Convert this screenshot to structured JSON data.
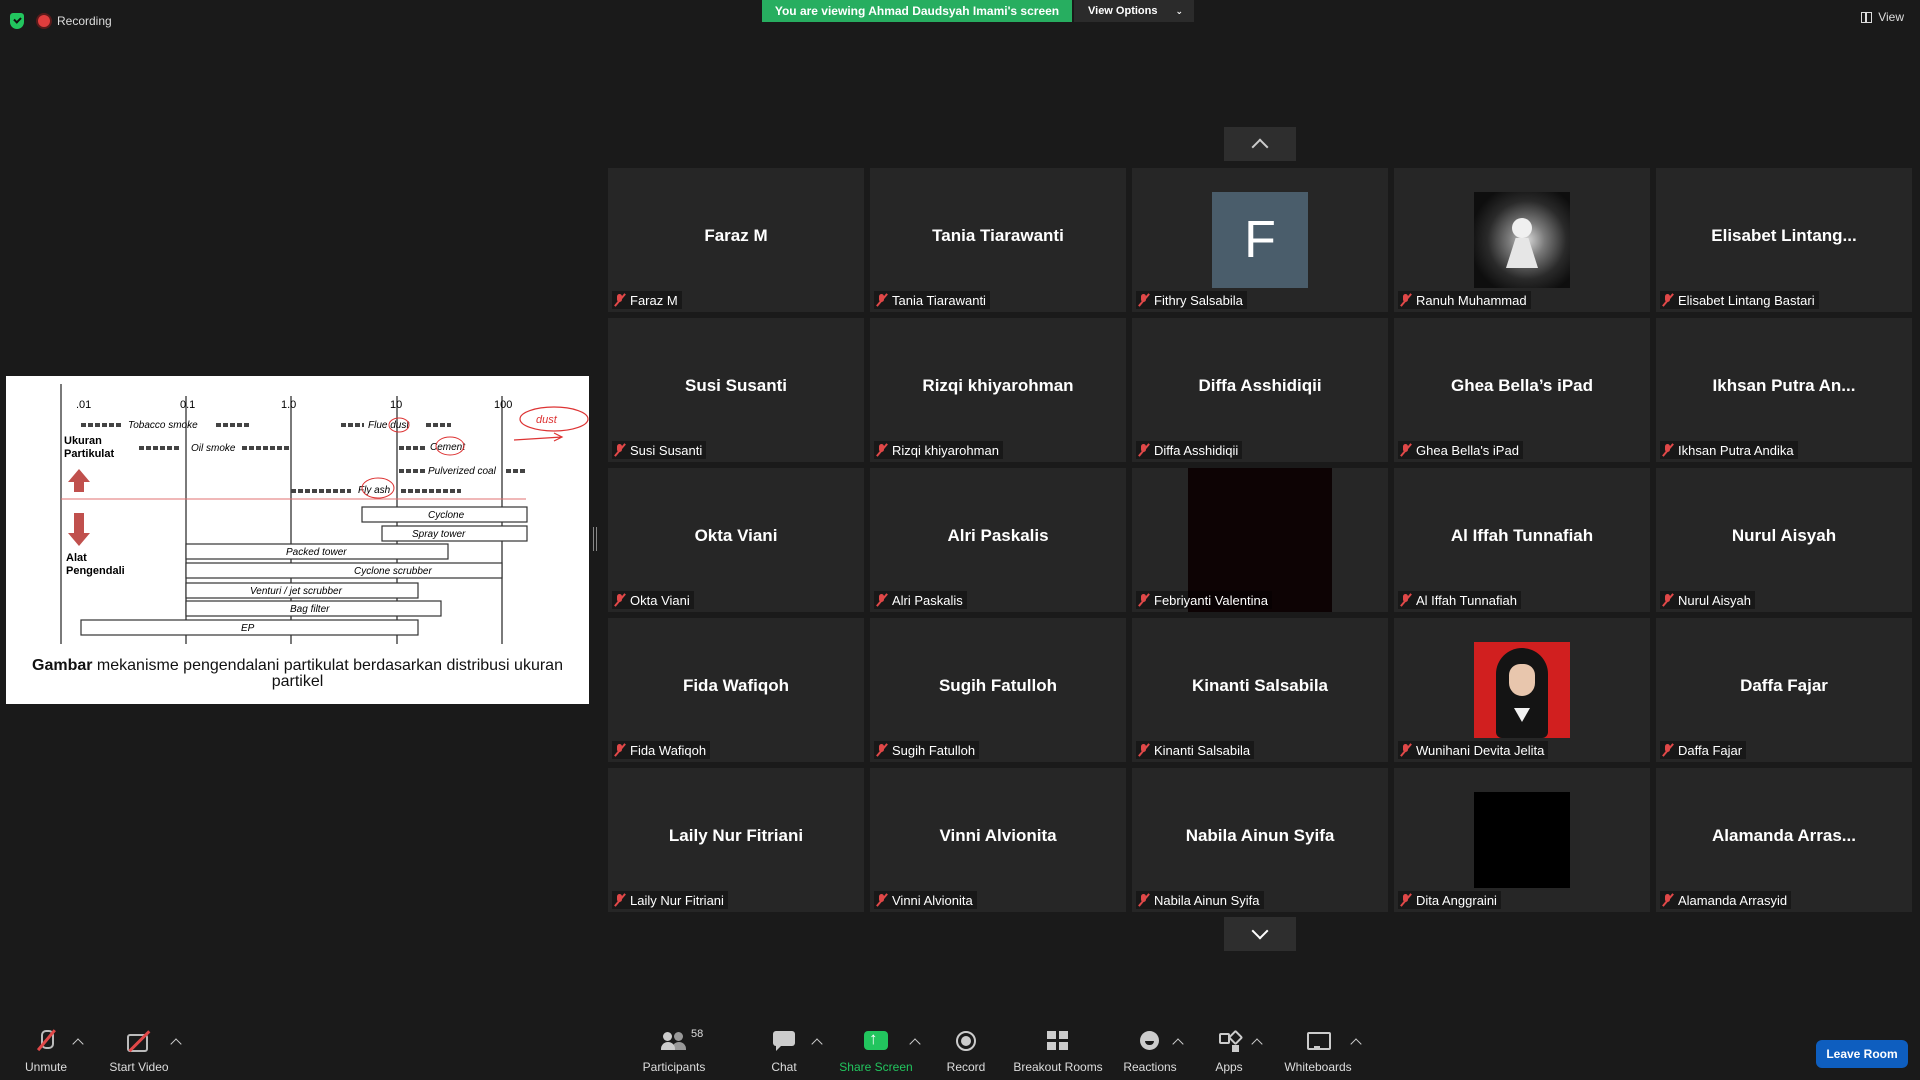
{
  "top": {
    "recording_label": "Recording",
    "banner_text": "You are viewing Ahmad Daudsyah Imami's screen",
    "view_options_label": "View Options",
    "view_label": "View"
  },
  "share": {
    "chart_ticks": [
      ".01",
      "0.1",
      "1.0",
      "10",
      "100"
    ],
    "chart_labels": {
      "ukuran_1": "Ukuran",
      "ukuran_2": "Partikulat",
      "alat_1": "Alat",
      "alat_2": "Pengendali",
      "tobacco": "Tobacco smoke",
      "oil": "Oil smoke",
      "flue": "Flue dust",
      "cement": "Cement",
      "pulverized": "Pulverized coal",
      "flyash": "Fly ash",
      "cyclone": "Cyclone",
      "spray": "Spray tower",
      "packed": "Packed tower",
      "cyclone_scrubber": "Cyclone scrubber",
      "venturi": "Venturi / jet scrubber",
      "bag": "Bag filter",
      "ep": "EP",
      "handwritten": "dust"
    },
    "caption_bold": "Gambar",
    "caption_text": " mekanisme pengendalani partikulat berdasarkan distribusi ukuran partikel"
  },
  "participants": [
    {
      "display": "Faraz M",
      "label": "Faraz M",
      "avatar": "none"
    },
    {
      "display": "Tania Tiarawanti",
      "label": "Tania Tiarawanti",
      "avatar": "none"
    },
    {
      "display": "F",
      "label": "Fithry Salsabila",
      "avatar": "letter"
    },
    {
      "display": "",
      "label": "Ranuh Muhammad",
      "avatar": "chess-photo"
    },
    {
      "display": "Elisabet  Lintang...",
      "label": "Elisabet Lintang Bastari",
      "avatar": "none"
    },
    {
      "display": "Susi Susanti",
      "label": "Susi Susanti",
      "avatar": "none"
    },
    {
      "display": "Rizqi khiyarohman",
      "label": "Rizqi khiyarohman",
      "avatar": "none"
    },
    {
      "display": "Diffa Asshidiqii",
      "label": "Diffa Asshidiqii",
      "avatar": "none"
    },
    {
      "display": "Ghea Bella’s iPad",
      "label": "Ghea Bella's iPad",
      "avatar": "none"
    },
    {
      "display": "Ikhsan Putra An...",
      "label": "Ikhsan Putra Andika",
      "avatar": "none"
    },
    {
      "display": "Okta Viani",
      "label": "Okta Viani",
      "avatar": "none"
    },
    {
      "display": "Alri Paskalis",
      "label": "Alri Paskalis",
      "avatar": "none"
    },
    {
      "display": "",
      "label": "Febriyanti Valentina",
      "avatar": "dark-video"
    },
    {
      "display": "Al Iffah Tunnafiah",
      "label": "Al Iffah Tunnafiah",
      "avatar": "none"
    },
    {
      "display": "Nurul Aisyah",
      "label": "Nurul Aisyah",
      "avatar": "none"
    },
    {
      "display": "Fida Wafiqoh",
      "label": "Fida Wafiqoh",
      "avatar": "none"
    },
    {
      "display": "Sugih Fatulloh",
      "label": "Sugih Fatulloh",
      "avatar": "none"
    },
    {
      "display": "Kinanti Salsabila",
      "label": "Kinanti Salsabila",
      "avatar": "none"
    },
    {
      "display": "",
      "label": "Wunihani Devita Jelita",
      "avatar": "person-photo"
    },
    {
      "display": "Daffa Fajar",
      "label": "Daffa Fajar",
      "avatar": "none"
    },
    {
      "display": "Laily Nur Fitriani",
      "label": "Laily Nur Fitriani",
      "avatar": "none"
    },
    {
      "display": "Vinni Alvionita",
      "label": "Vinni Alvionita",
      "avatar": "none"
    },
    {
      "display": "Nabila Ainun Syifa",
      "label": "Nabila Ainun Syifa",
      "avatar": "none"
    },
    {
      "display": "",
      "label": "Dita Anggraini",
      "avatar": "black"
    },
    {
      "display": "Alamanda  Arras...",
      "label": "Alamanda Arrasyid",
      "avatar": "none"
    }
  ],
  "toolbar": {
    "unmute": "Unmute",
    "start_video": "Start Video",
    "participants_count": "58",
    "participants": "Participants",
    "chat": "Chat",
    "share_screen": "Share Screen",
    "record": "Record",
    "breakout": "Breakout Rooms",
    "reactions": "Reactions",
    "apps": "Apps",
    "whiteboards": "Whiteboards",
    "leave": "Leave Room"
  },
  "colors": {
    "background": "#1a1a1a",
    "tile": "#262626",
    "banner_green": "#27ae60",
    "share_green": "#22c55e",
    "muted_red": "#e04848",
    "leave_blue": "#0e5ebf"
  }
}
